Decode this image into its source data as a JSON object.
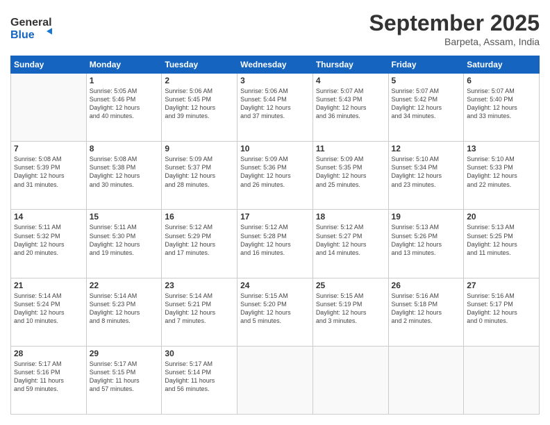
{
  "header": {
    "logo_line1": "General",
    "logo_line2": "Blue",
    "month": "September 2025",
    "location": "Barpeta, Assam, India"
  },
  "weekdays": [
    "Sunday",
    "Monday",
    "Tuesday",
    "Wednesday",
    "Thursday",
    "Friday",
    "Saturday"
  ],
  "weeks": [
    [
      {
        "day": "",
        "info": ""
      },
      {
        "day": "1",
        "info": "Sunrise: 5:05 AM\nSunset: 5:46 PM\nDaylight: 12 hours\nand 40 minutes."
      },
      {
        "day": "2",
        "info": "Sunrise: 5:06 AM\nSunset: 5:45 PM\nDaylight: 12 hours\nand 39 minutes."
      },
      {
        "day": "3",
        "info": "Sunrise: 5:06 AM\nSunset: 5:44 PM\nDaylight: 12 hours\nand 37 minutes."
      },
      {
        "day": "4",
        "info": "Sunrise: 5:07 AM\nSunset: 5:43 PM\nDaylight: 12 hours\nand 36 minutes."
      },
      {
        "day": "5",
        "info": "Sunrise: 5:07 AM\nSunset: 5:42 PM\nDaylight: 12 hours\nand 34 minutes."
      },
      {
        "day": "6",
        "info": "Sunrise: 5:07 AM\nSunset: 5:40 PM\nDaylight: 12 hours\nand 33 minutes."
      }
    ],
    [
      {
        "day": "7",
        "info": "Sunrise: 5:08 AM\nSunset: 5:39 PM\nDaylight: 12 hours\nand 31 minutes."
      },
      {
        "day": "8",
        "info": "Sunrise: 5:08 AM\nSunset: 5:38 PM\nDaylight: 12 hours\nand 30 minutes."
      },
      {
        "day": "9",
        "info": "Sunrise: 5:09 AM\nSunset: 5:37 PM\nDaylight: 12 hours\nand 28 minutes."
      },
      {
        "day": "10",
        "info": "Sunrise: 5:09 AM\nSunset: 5:36 PM\nDaylight: 12 hours\nand 26 minutes."
      },
      {
        "day": "11",
        "info": "Sunrise: 5:09 AM\nSunset: 5:35 PM\nDaylight: 12 hours\nand 25 minutes."
      },
      {
        "day": "12",
        "info": "Sunrise: 5:10 AM\nSunset: 5:34 PM\nDaylight: 12 hours\nand 23 minutes."
      },
      {
        "day": "13",
        "info": "Sunrise: 5:10 AM\nSunset: 5:33 PM\nDaylight: 12 hours\nand 22 minutes."
      }
    ],
    [
      {
        "day": "14",
        "info": "Sunrise: 5:11 AM\nSunset: 5:32 PM\nDaylight: 12 hours\nand 20 minutes."
      },
      {
        "day": "15",
        "info": "Sunrise: 5:11 AM\nSunset: 5:30 PM\nDaylight: 12 hours\nand 19 minutes."
      },
      {
        "day": "16",
        "info": "Sunrise: 5:12 AM\nSunset: 5:29 PM\nDaylight: 12 hours\nand 17 minutes."
      },
      {
        "day": "17",
        "info": "Sunrise: 5:12 AM\nSunset: 5:28 PM\nDaylight: 12 hours\nand 16 minutes."
      },
      {
        "day": "18",
        "info": "Sunrise: 5:12 AM\nSunset: 5:27 PM\nDaylight: 12 hours\nand 14 minutes."
      },
      {
        "day": "19",
        "info": "Sunrise: 5:13 AM\nSunset: 5:26 PM\nDaylight: 12 hours\nand 13 minutes."
      },
      {
        "day": "20",
        "info": "Sunrise: 5:13 AM\nSunset: 5:25 PM\nDaylight: 12 hours\nand 11 minutes."
      }
    ],
    [
      {
        "day": "21",
        "info": "Sunrise: 5:14 AM\nSunset: 5:24 PM\nDaylight: 12 hours\nand 10 minutes."
      },
      {
        "day": "22",
        "info": "Sunrise: 5:14 AM\nSunset: 5:23 PM\nDaylight: 12 hours\nand 8 minutes."
      },
      {
        "day": "23",
        "info": "Sunrise: 5:14 AM\nSunset: 5:21 PM\nDaylight: 12 hours\nand 7 minutes."
      },
      {
        "day": "24",
        "info": "Sunrise: 5:15 AM\nSunset: 5:20 PM\nDaylight: 12 hours\nand 5 minutes."
      },
      {
        "day": "25",
        "info": "Sunrise: 5:15 AM\nSunset: 5:19 PM\nDaylight: 12 hours\nand 3 minutes."
      },
      {
        "day": "26",
        "info": "Sunrise: 5:16 AM\nSunset: 5:18 PM\nDaylight: 12 hours\nand 2 minutes."
      },
      {
        "day": "27",
        "info": "Sunrise: 5:16 AM\nSunset: 5:17 PM\nDaylight: 12 hours\nand 0 minutes."
      }
    ],
    [
      {
        "day": "28",
        "info": "Sunrise: 5:17 AM\nSunset: 5:16 PM\nDaylight: 11 hours\nand 59 minutes."
      },
      {
        "day": "29",
        "info": "Sunrise: 5:17 AM\nSunset: 5:15 PM\nDaylight: 11 hours\nand 57 minutes."
      },
      {
        "day": "30",
        "info": "Sunrise: 5:17 AM\nSunset: 5:14 PM\nDaylight: 11 hours\nand 56 minutes."
      },
      {
        "day": "",
        "info": ""
      },
      {
        "day": "",
        "info": ""
      },
      {
        "day": "",
        "info": ""
      },
      {
        "day": "",
        "info": ""
      }
    ]
  ]
}
